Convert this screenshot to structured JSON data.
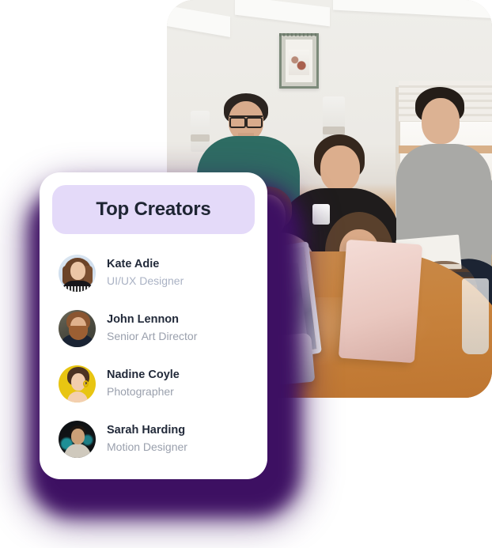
{
  "card": {
    "title": "Top Creators",
    "header_bg": "#E4DAF9",
    "title_color": "#1E2533",
    "background": "#FFFFFF",
    "glow_color": "#3D1062",
    "creators": [
      {
        "name": "Kate Adie",
        "role": "UI/UX Designer",
        "avatar": "avatar-kate-adie",
        "avatar_bg": "#CDDCEC"
      },
      {
        "name": "John Lennon",
        "role": "Senior Art Director",
        "avatar": "avatar-john-lennon",
        "avatar_bg": "#4E4D42"
      },
      {
        "name": "Nadine Coyle",
        "role": "Photographer",
        "avatar": "avatar-nadine-coyle",
        "avatar_bg": "#E8C512"
      },
      {
        "name": "Sarah Harding",
        "role": "Motion Designer",
        "avatar": "avatar-sarah-harding",
        "avatar_bg": "#121618"
      }
    ]
  },
  "photo": {
    "alt": "Team of five people gathered around a wooden meeting table with laptops in a bright white room"
  }
}
